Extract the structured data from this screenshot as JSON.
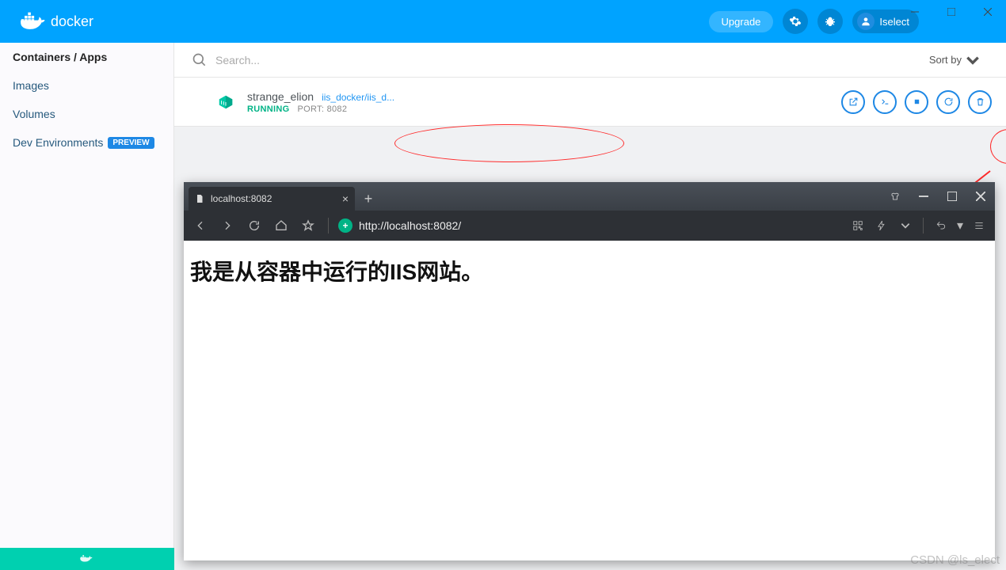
{
  "header": {
    "brand": "docker",
    "upgrade": "Upgrade",
    "username": "Iselect"
  },
  "sidebar": {
    "items": [
      {
        "label": "Containers / Apps"
      },
      {
        "label": "Images"
      },
      {
        "label": "Volumes"
      },
      {
        "label": "Dev Environments"
      }
    ],
    "preview_badge": "PREVIEW"
  },
  "search": {
    "placeholder": "Search...",
    "sort_label": "Sort by"
  },
  "container": {
    "name": "strange_elion",
    "image": "iis_docker/iis_d...",
    "status": "RUNNING",
    "port_label": "PORT: 8082"
  },
  "browser": {
    "tab_title": "localhost:8082",
    "url": "http://localhost:8082/",
    "page_heading": "我是从容器中运行的IIS网站。"
  },
  "watermark": "CSDN @ls_elect"
}
